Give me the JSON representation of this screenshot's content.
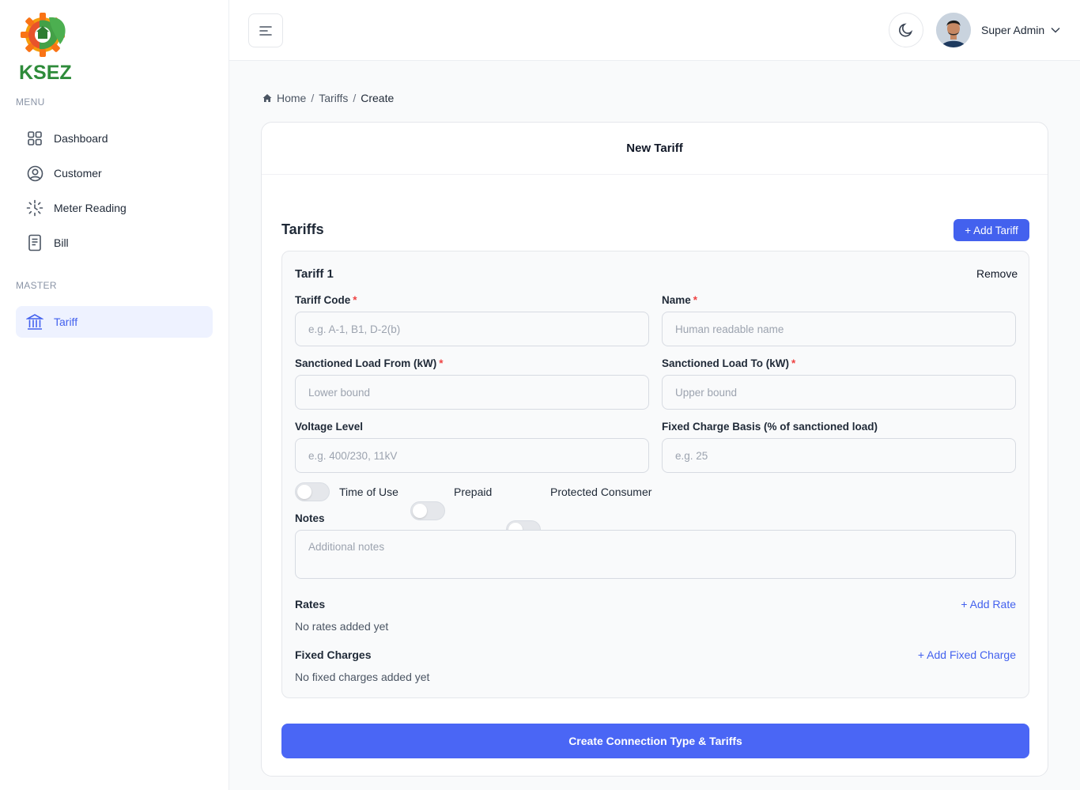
{
  "sidebar": {
    "logo_text": "KSEZ",
    "menu_label": "MENU",
    "master_label": "MASTER",
    "items": [
      {
        "label": "Dashboard",
        "icon": "grid-icon"
      },
      {
        "label": "Customer",
        "icon": "user-circle-icon"
      },
      {
        "label": "Meter Reading",
        "icon": "meter-icon"
      },
      {
        "label": "Bill",
        "icon": "bill-icon"
      }
    ],
    "master_items": [
      {
        "label": "Tariff",
        "icon": "bank-icon",
        "active": true
      }
    ]
  },
  "header": {
    "user_name": "Super Admin"
  },
  "breadcrumb": {
    "home": "Home",
    "tariffs": "Tariffs",
    "current": "Create",
    "separator": "/"
  },
  "card": {
    "title": "New Tariff",
    "tariffs_heading": "Tariffs",
    "add_tariff_label": "+ Add Tariff",
    "tariff": {
      "title": "Tariff 1",
      "remove_label": "Remove",
      "fields": {
        "code": {
          "label": "Tariff Code",
          "placeholder": "e.g. A-1, B1, D-2(b)",
          "value": ""
        },
        "name": {
          "label": "Name",
          "placeholder": "Human readable name",
          "value": ""
        },
        "load_from": {
          "label": "Sanctioned Load From (kW)",
          "placeholder": "Lower bound",
          "value": ""
        },
        "load_to": {
          "label": "Sanctioned Load To (kW)",
          "placeholder": "Upper bound",
          "value": ""
        },
        "voltage": {
          "label": "Voltage Level",
          "placeholder": "e.g. 400/230, 11kV",
          "value": ""
        },
        "fixed_basis": {
          "label": "Fixed Charge Basis (% of sanctioned load)",
          "placeholder": "e.g. 25",
          "value": ""
        },
        "notes": {
          "label": "Notes",
          "placeholder": "Additional notes",
          "value": ""
        }
      },
      "required_mark": "*",
      "toggles": [
        {
          "label": "Time of Use",
          "on": false
        },
        {
          "label": "Prepaid",
          "on": false
        },
        {
          "label": "Protected Consumer",
          "on": false
        }
      ],
      "rates": {
        "title": "Rates",
        "add_label": "+ Add Rate",
        "empty": "No rates added yet"
      },
      "fixed_charges": {
        "title": "Fixed Charges",
        "add_label": "+ Add Fixed Charge",
        "empty": "No fixed charges added yet"
      }
    },
    "submit_label": "Create Connection Type & Tariffs"
  },
  "colors": {
    "accent": "#4361ee",
    "required": "#ef4444",
    "active_bg": "#eef2ff"
  }
}
